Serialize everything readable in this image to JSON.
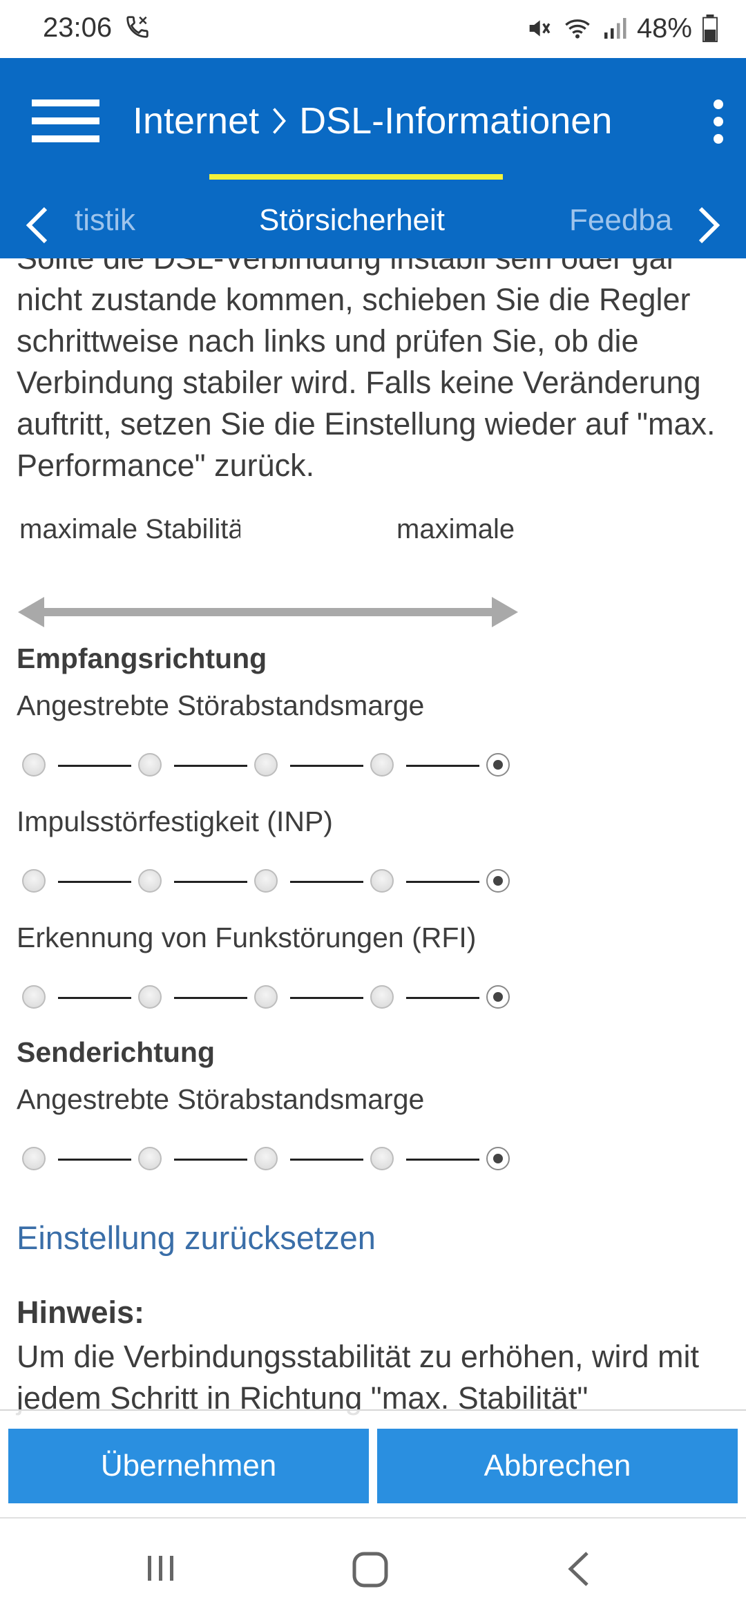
{
  "status_bar": {
    "time": "23:06",
    "battery": "48%",
    "icons": [
      "call-icon",
      "mute-icon",
      "wifi-icon",
      "signal-icon",
      "battery-icon"
    ]
  },
  "app_bar": {
    "title_part1": "Internet",
    "title_part2": "DSL-Informationen",
    "background": "#0a6ac4"
  },
  "tabs": {
    "items": [
      "tistik",
      "Störsicherheit",
      "Feedba"
    ],
    "active": "Störsicherheit",
    "underline_color": "#f2f23a"
  },
  "content": {
    "intro": "Sollte die DSL-Verbindung instabil sein oder gar nicht zustande kommen, schieben Sie die Regler schrittweise nach links und prüfen Sie, ob die Verbindung stabiler wird. Falls keine Veränderung auftritt, setzen Sie die Einstellung wieder auf \"max. Performance\" zurück.",
    "scale_left": "maximale Stabilität",
    "scale_right": "maximale Performance",
    "receive_heading": "Empfangsrichtung",
    "send_heading": "Senderichtung",
    "sliders": [
      {
        "label": "Angestrebte Störabstandsmarge",
        "steps": 5,
        "selected": 5
      },
      {
        "label": "Impulsstörfestigkeit (INP)",
        "steps": 5,
        "selected": 5
      },
      {
        "label": "Erkennung von Funkstörungen (RFI)",
        "steps": 5,
        "selected": 5
      },
      {
        "label": "Angestrebte Störabstandsmarge",
        "steps": 5,
        "selected": 5
      }
    ],
    "reset_link": "Einstellung zurücksetzen",
    "hint_title": "Hinweis:",
    "hint_text": "Um die Verbindungsstabilität zu erhöhen, wird mit jedem Schritt in Richtung \"max. Stabilität\""
  },
  "buttons": {
    "apply": "Übernehmen",
    "cancel": "Abbrechen",
    "color": "#2a8fe0"
  },
  "nav_bar": {
    "icons": [
      "recents-icon",
      "home-icon",
      "back-icon"
    ]
  }
}
